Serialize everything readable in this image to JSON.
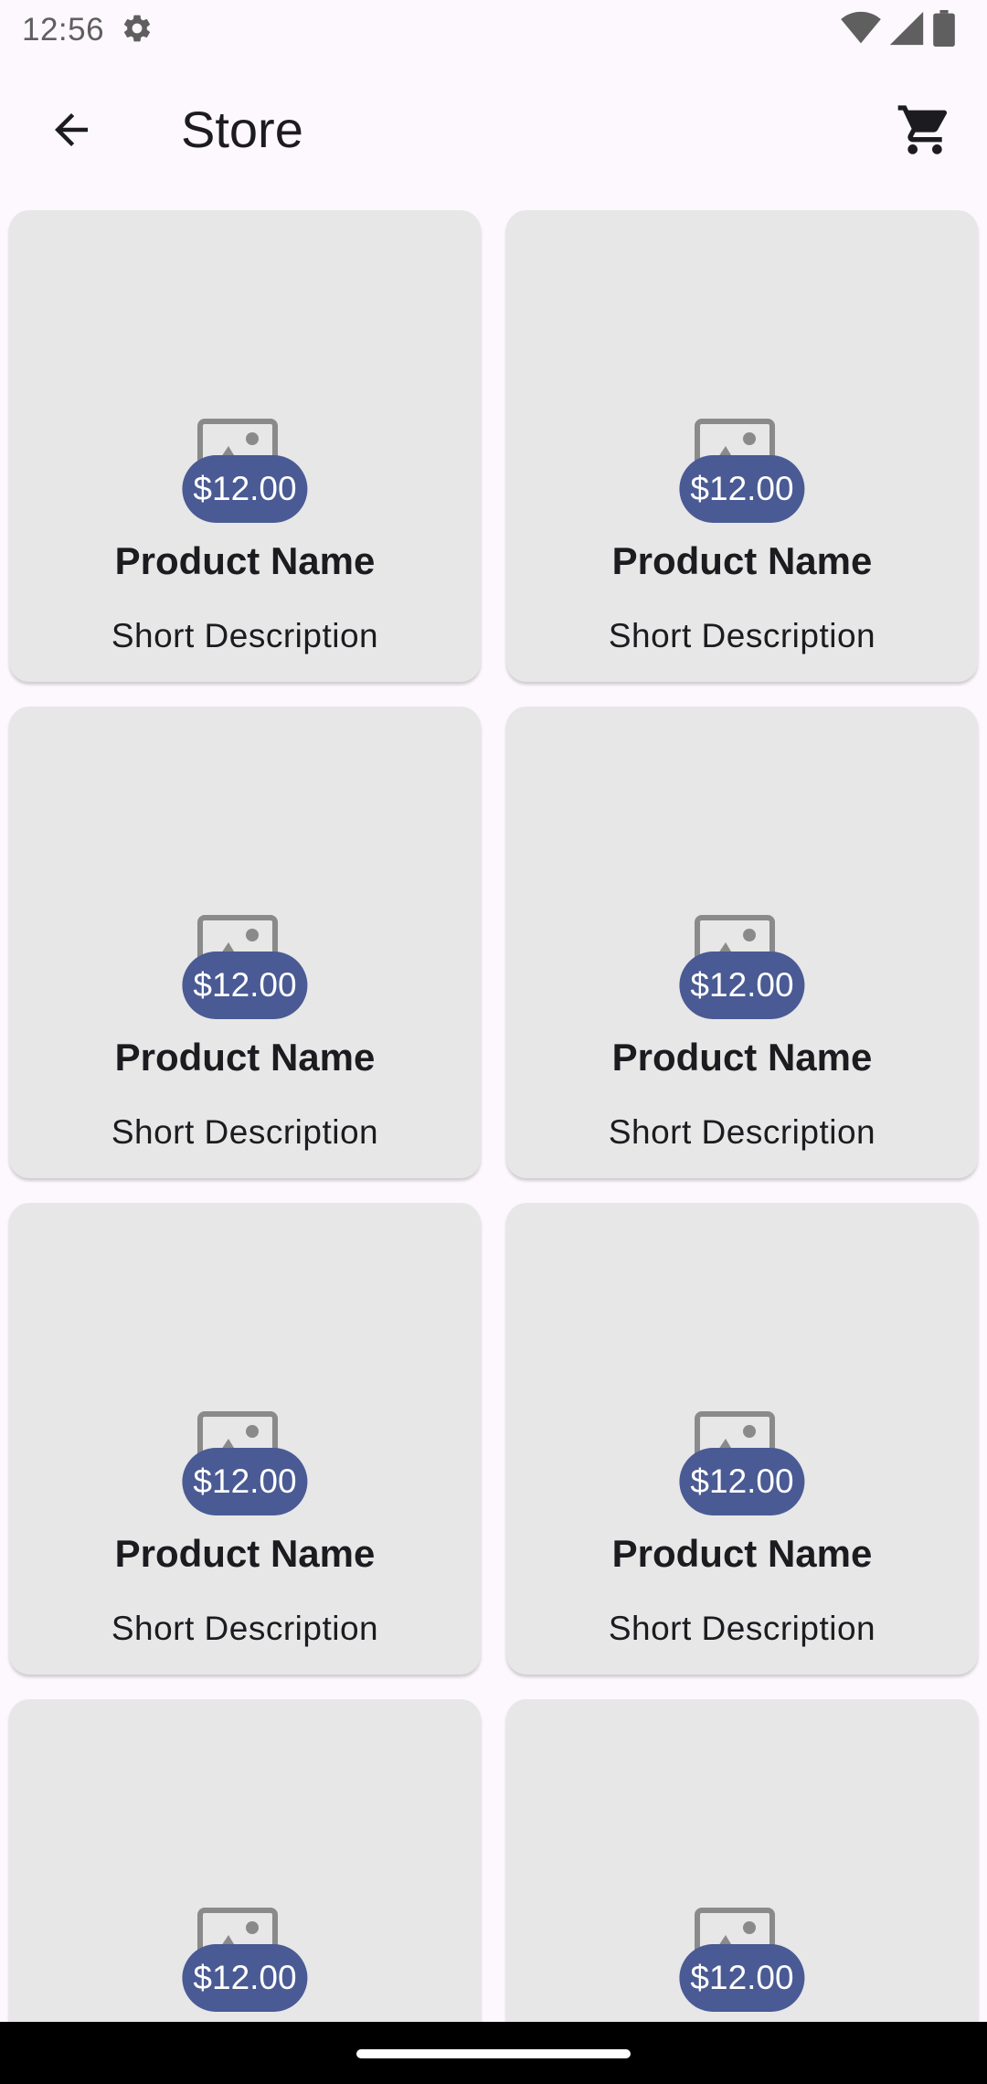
{
  "status_bar": {
    "time": "12:56",
    "icons": [
      "settings-icon",
      "wifi-icon",
      "signal-icon",
      "battery-icon"
    ]
  },
  "app_bar": {
    "title": "Store",
    "back_icon": "arrow-back-icon",
    "cart_icon": "shopping-cart-icon"
  },
  "colors": {
    "background": "#fdf8fd",
    "card": "#e7e7e7",
    "price_badge": "#4a5a94"
  },
  "products": [
    {
      "price": "$12.00",
      "name": "Product Name",
      "description": "Short Description"
    },
    {
      "price": "$12.00",
      "name": "Product Name",
      "description": "Short Description"
    },
    {
      "price": "$12.00",
      "name": "Product Name",
      "description": "Short Description"
    },
    {
      "price": "$12.00",
      "name": "Product Name",
      "description": "Short Description"
    },
    {
      "price": "$12.00",
      "name": "Product Name",
      "description": "Short Description"
    },
    {
      "price": "$12.00",
      "name": "Product Name",
      "description": "Short Description"
    },
    {
      "price": "$12.00"
    },
    {
      "price": "$12.00"
    }
  ]
}
